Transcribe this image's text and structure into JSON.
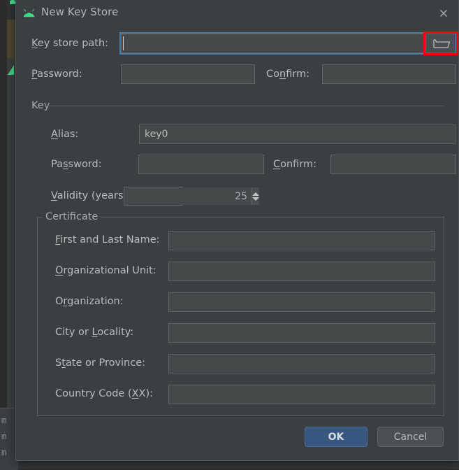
{
  "window": {
    "title": "New Key Store",
    "icon": "android-robot-icon",
    "close_icon": "close-icon",
    "accent_focus_color": "#4a7ba6",
    "highlight_color": "#ff0000",
    "background_color": "#3c3f41"
  },
  "keystore": {
    "path_label_pre": "",
    "path_label_mnemonic": "K",
    "path_label_post": "ey store path:",
    "path_value": "",
    "path_placeholder": "",
    "browse_icon": "folder-icon",
    "password_label_mnemonic": "P",
    "password_label_post": "assword:",
    "password_value": "",
    "confirm_label_pre": "Co",
    "confirm_label_mnemonic": "n",
    "confirm_label_post": "firm:",
    "confirm_value": ""
  },
  "key_group": {
    "title": "Key",
    "alias": {
      "label_mnemonic": "A",
      "label_post": "lias:",
      "value": "key0"
    },
    "password": {
      "label_pre": "Pa",
      "label_mnemonic": "s",
      "label_post": "sword:",
      "value": ""
    },
    "confirm": {
      "label_mnemonic": "C",
      "label_post": "onfirm:",
      "value": ""
    },
    "validity": {
      "label_mnemonic": "V",
      "label_post": "alidity (years):",
      "value": "25"
    }
  },
  "certificate_group": {
    "title": "Certificate",
    "fields": [
      {
        "label_pre": "",
        "label_mnemonic": "F",
        "label_post": "irst and Last Name:",
        "value": ""
      },
      {
        "label_pre": "",
        "label_mnemonic": "O",
        "label_post": "rganizational Unit:",
        "value": ""
      },
      {
        "label_pre": "O",
        "label_mnemonic": "r",
        "label_post": "ganization:",
        "value": ""
      },
      {
        "label_pre": "City or ",
        "label_mnemonic": "L",
        "label_post": "ocality:",
        "value": ""
      },
      {
        "label_pre": "S",
        "label_mnemonic": "t",
        "label_post": "ate or Province:",
        "value": ""
      },
      {
        "label_pre": "Country Code (",
        "label_mnemonic": "X",
        "label_post": "X):",
        "value": ""
      }
    ]
  },
  "footer": {
    "ok_label": "OK",
    "cancel_label": "Cancel"
  },
  "background": {
    "cut_text": [
      "m",
      "m",
      "m"
    ]
  }
}
